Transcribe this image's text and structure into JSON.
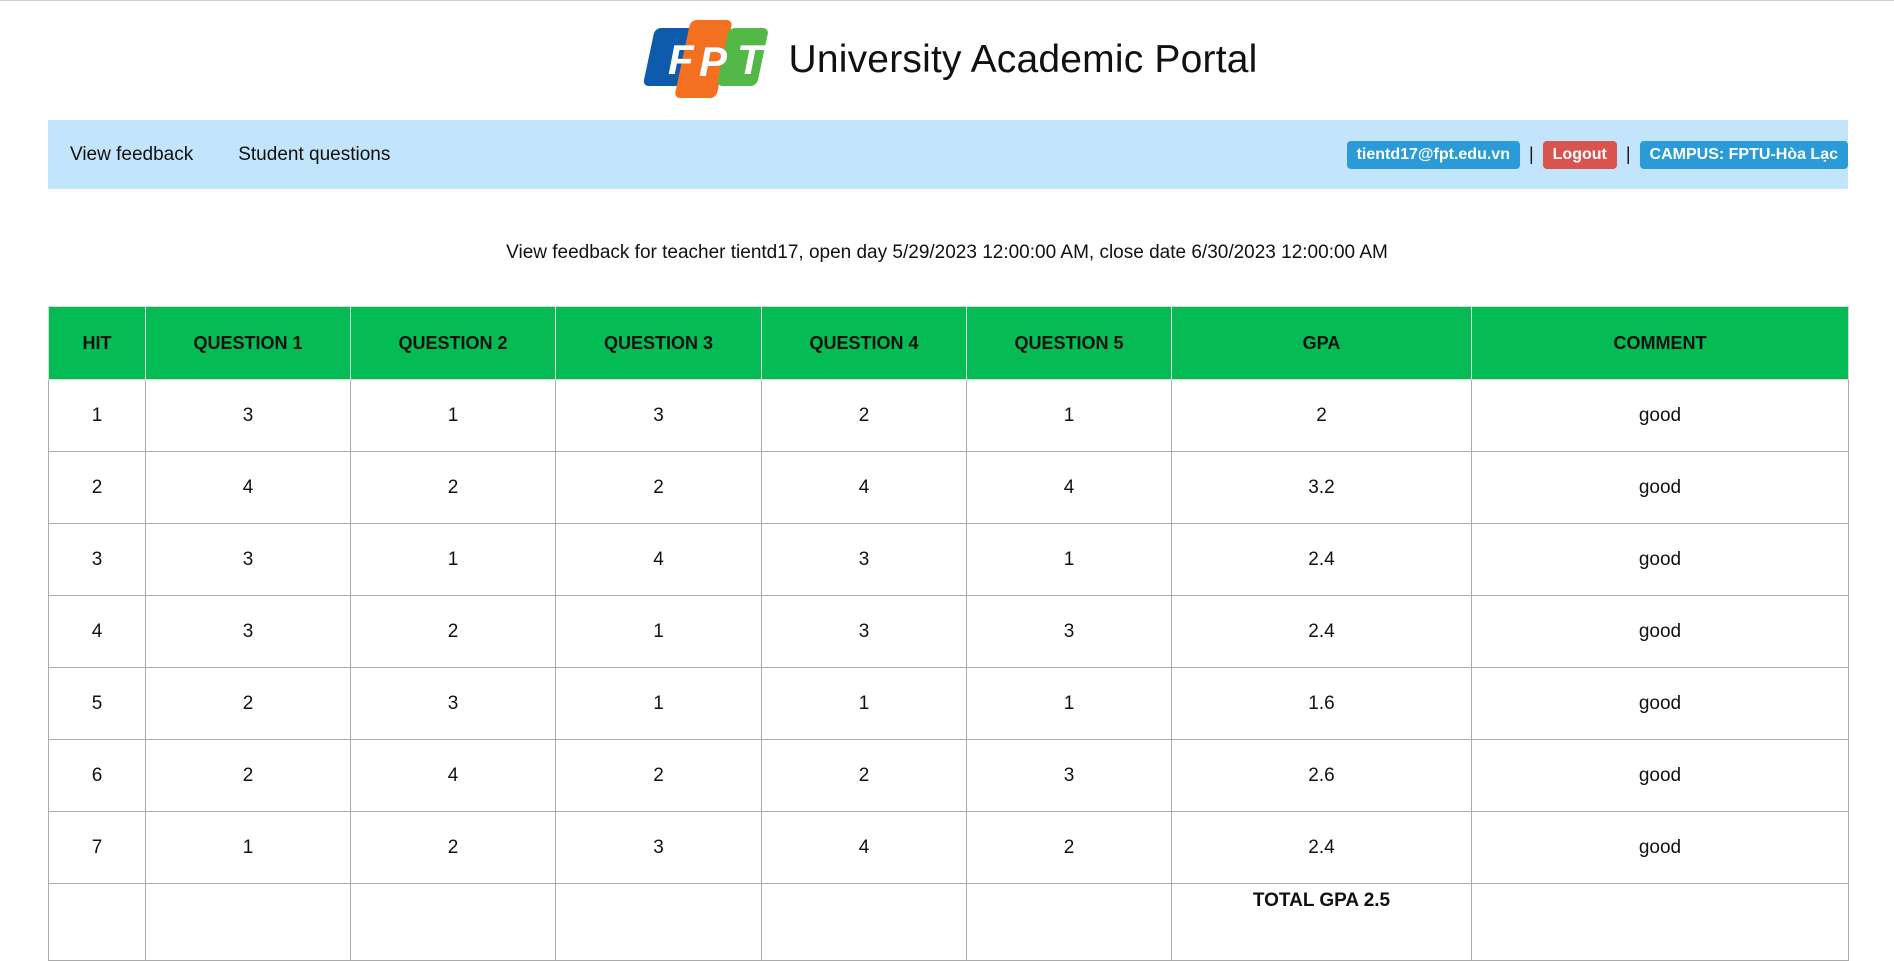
{
  "header": {
    "logo_letters": [
      "F",
      "P",
      "T"
    ],
    "title": "University Academic Portal"
  },
  "nav": {
    "links": [
      "View feedback",
      "Student questions"
    ],
    "user_email": "tientd17@fpt.edu.vn",
    "separator": "|",
    "logout_label": "Logout",
    "campus_label": "CAMPUS: FPTU-Hòa Lạc"
  },
  "subtitle": "View feedback for teacher tientd17, open day 5/29/2023 12:00:00 AM, close date 6/30/2023 12:00:00 AM",
  "table": {
    "columns": [
      "HIT",
      "QUESTION 1",
      "QUESTION 2",
      "QUESTION 3",
      "QUESTION 4",
      "QUESTION 5",
      "GPA",
      "COMMENT"
    ],
    "rows": [
      [
        "1",
        "3",
        "1",
        "3",
        "2",
        "1",
        "2",
        "good"
      ],
      [
        "2",
        "4",
        "2",
        "2",
        "4",
        "4",
        "3.2",
        "good"
      ],
      [
        "3",
        "3",
        "1",
        "4",
        "3",
        "1",
        "2.4",
        "good"
      ],
      [
        "4",
        "3",
        "2",
        "1",
        "3",
        "3",
        "2.4",
        "good"
      ],
      [
        "5",
        "2",
        "3",
        "1",
        "1",
        "1",
        "1.6",
        "good"
      ],
      [
        "6",
        "2",
        "4",
        "2",
        "2",
        "3",
        "2.6",
        "good"
      ],
      [
        "7",
        "1",
        "2",
        "3",
        "4",
        "2",
        "2.4",
        "good"
      ]
    ],
    "total_label": "TOTAL GPA 2.5"
  },
  "colors": {
    "logo_blue": "#0f5bab",
    "logo_orange": "#f37021",
    "logo_green": "#52b848",
    "nav_bg": "#c2e5fb",
    "header_green": "#05bb53",
    "total_red": "#e01010"
  }
}
